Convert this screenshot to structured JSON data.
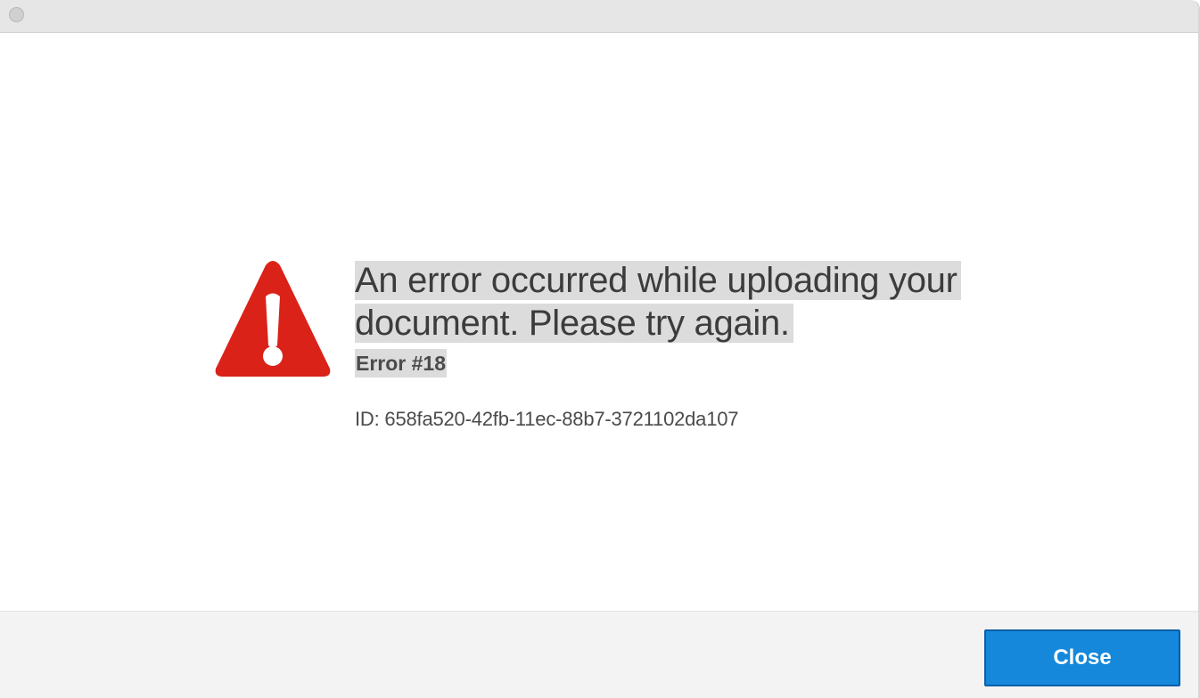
{
  "dialog": {
    "headline": "An error occurred while uploading your document. Please try again.",
    "error_code": "Error #18",
    "error_id": "ID: 658fa520-42fb-11ec-88b7-3721102da107",
    "close_label": "Close"
  },
  "icons": {
    "window_control": "window-close-dot-icon",
    "alert": "warning-triangle-icon"
  },
  "colors": {
    "alert_red": "#da2218",
    "button_blue": "#1588dc",
    "highlight_gray": "#dcdcdc"
  }
}
